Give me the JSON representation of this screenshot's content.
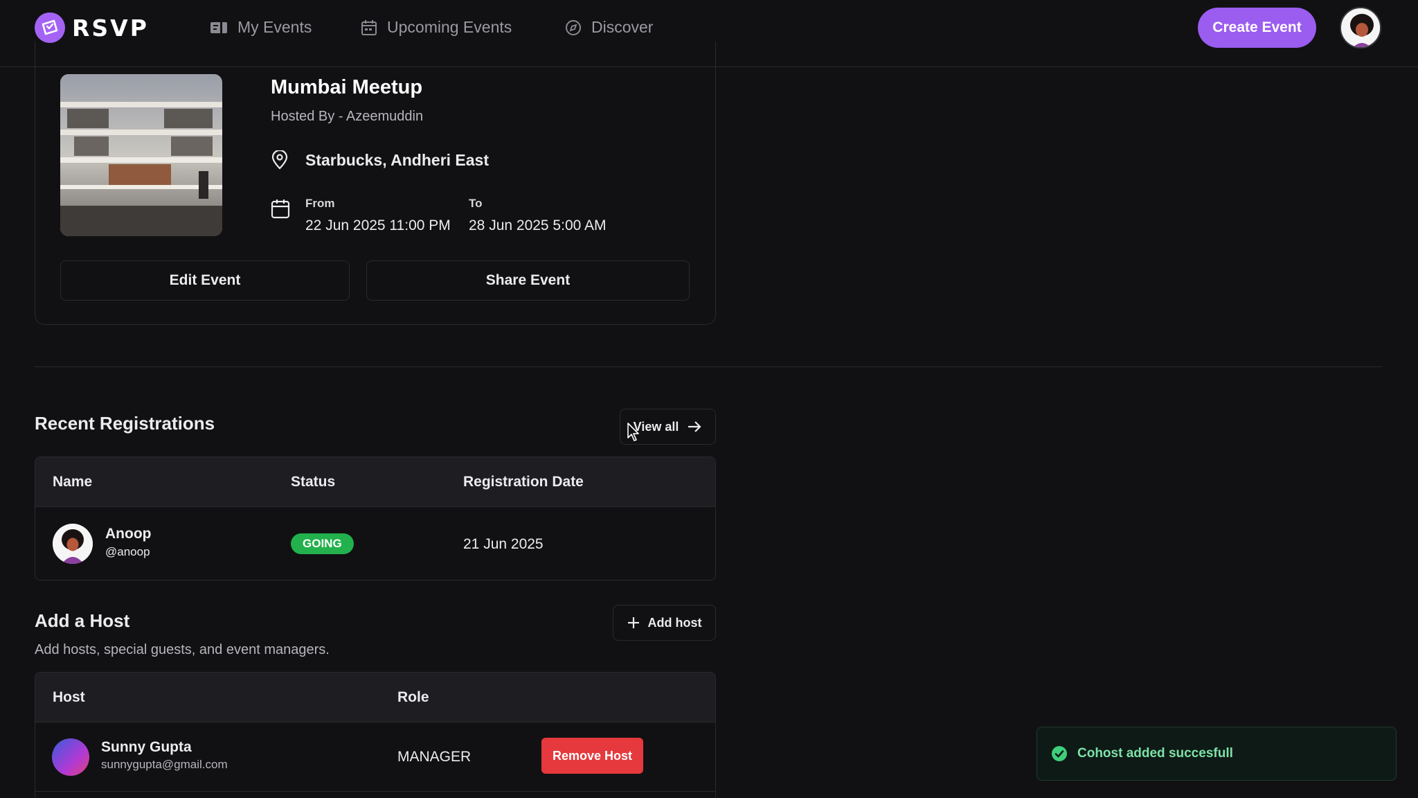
{
  "nav": {
    "logo_text": "RSVP",
    "items": [
      {
        "label": "My Events",
        "icon": "ticket-icon"
      },
      {
        "label": "Upcoming Events",
        "icon": "calendar-icon"
      },
      {
        "label": "Discover",
        "icon": "compass-icon"
      }
    ],
    "create_label": "Create Event"
  },
  "event": {
    "title": "Mumbai Meetup",
    "hosted_by": "Hosted By - Azeemuddin",
    "location": "Starbucks, Andheri East",
    "from_label": "From",
    "from_value": "22 Jun 2025 11:00 PM",
    "to_label": "To",
    "to_value": "28 Jun 2025 5:00 AM",
    "edit_label": "Edit Event",
    "share_label": "Share Event"
  },
  "registrations": {
    "title": "Recent Registrations",
    "view_all_label": "View all",
    "columns": [
      "Name",
      "Status",
      "Registration Date"
    ],
    "rows": [
      {
        "name": "Anoop",
        "handle": "@anoop",
        "status": "GOING",
        "date": "21 Jun 2025"
      }
    ]
  },
  "hosts": {
    "title": "Add a Host",
    "subtitle": "Add hosts, special guests, and event managers.",
    "add_label": "Add host",
    "columns": [
      "Host",
      "Role"
    ],
    "rows": [
      {
        "name": "Sunny Gupta",
        "email": "sunnygupta@gmail.com",
        "role": "MANAGER",
        "action": "Remove Host"
      }
    ]
  },
  "toast": {
    "message": "Cohost added succesfull"
  },
  "colors": {
    "accent": "#9b5cf0",
    "success": "#22b14c",
    "danger": "#e5393d",
    "background": "#111113"
  }
}
